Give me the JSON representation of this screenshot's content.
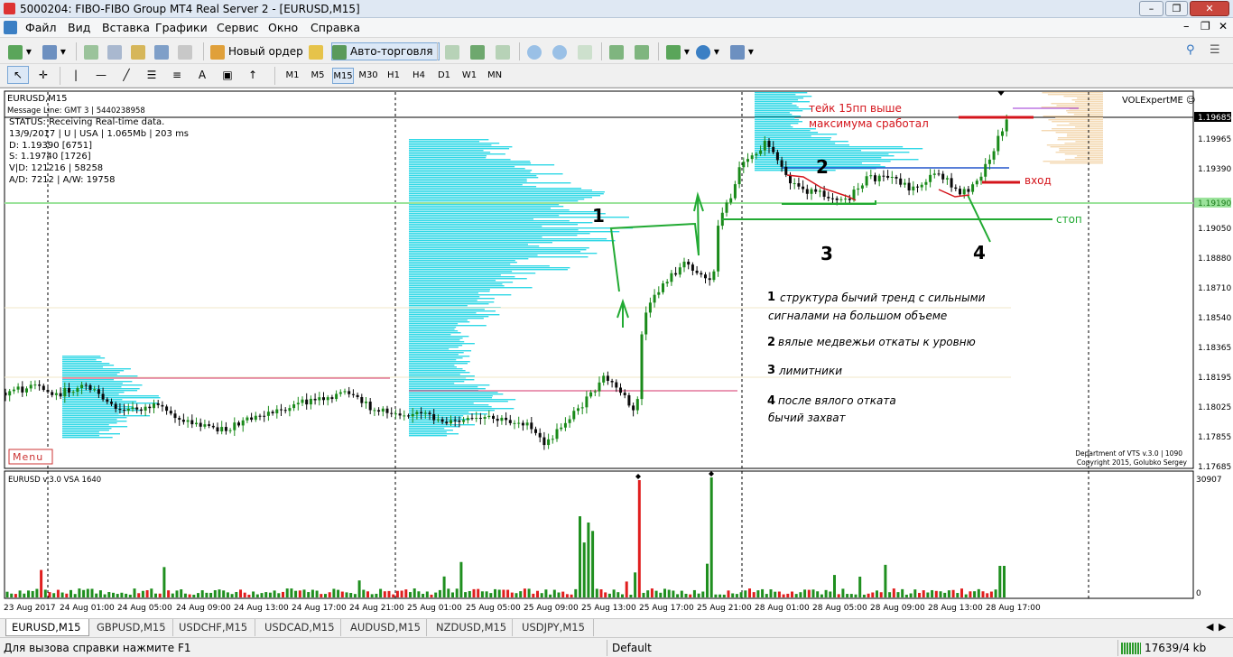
{
  "window": {
    "title": "5000204: FIBO-FIBO Group MT4 Real Server 2 - [EURUSD,M15]",
    "min": "–",
    "restore": "❐",
    "close": "✕"
  },
  "menu": [
    "Файл",
    "Вид",
    "Вставка",
    "Графики",
    "Сервис",
    "Окно",
    "Справка"
  ],
  "toolbar": {
    "new_order": "Новый ордер",
    "auto_trading": "Авто-торговля",
    "timeframes": [
      "M1",
      "M5",
      "M15",
      "M30",
      "H1",
      "H4",
      "D1",
      "W1",
      "MN"
    ],
    "active_timeframe": "M15"
  },
  "chart": {
    "symbol_line": "EURUSD,M15",
    "info_lines": [
      "Message Line: GMT 3 | 5440238958",
      "STATUS: Receiving Real-time data.",
      "13/9/2017 | U | USA | 1.065Mb | 203 ms",
      "D: 1.19390  [6751]",
      "S: 1.19740  [1726]",
      "V|D: 121216 | 58258",
      "A/D: 7212 | A/W: 19758"
    ],
    "expert": "VOLExpertME ☺",
    "menu_button": "Menu",
    "copyright_1": "Department of VTS  v.3.0 | 1090",
    "copyright_2": "Copyright 2015, Golubko Sergey",
    "indicator_label": "EURUSD v.3.0 VSA 1640",
    "price_labels": [
      "1.19965",
      "1.19390",
      "1.19050",
      "1.18880",
      "1.18710",
      "1.18540",
      "1.18365",
      "1.18195",
      "1.18025",
      "1.17855",
      "1.17685"
    ],
    "current_price": "1.19685",
    "line_price": "1.19190",
    "volume_labels": [
      "30907",
      "0"
    ],
    "time_labels": [
      "23 Aug 2017",
      "24 Aug 01:00",
      "24 Aug 05:00",
      "24 Aug 09:00",
      "24 Aug 13:00",
      "24 Aug 17:00",
      "24 Aug 21:00",
      "25 Aug 01:00",
      "25 Aug 05:00",
      "25 Aug 09:00",
      "25 Aug 13:00",
      "25 Aug 17:00",
      "25 Aug 21:00",
      "28 Aug 01:00",
      "28 Aug 05:00",
      "28 Aug 09:00",
      "28 Aug 13:00",
      "28 Aug 17:00"
    ],
    "annotations": {
      "take": [
        "тейк 15пп выше",
        "максимума сработал"
      ],
      "entry": "вход",
      "stop": "стоп",
      "num1": "1",
      "num2": "2",
      "num3": "3",
      "num4": "4",
      "note1_num": "1",
      "note1_a": "структура бычий тренд с сильными",
      "note1_b": "сигналами на большом объеме",
      "note2_num": "2",
      "note2": "вялые медвежьи откаты к уровню",
      "note3_num": "3",
      "note3": "лимитники",
      "note4_num": "4",
      "note4_a": "после вялого отката",
      "note4_b": "бычий захват"
    },
    "colors": {
      "bull": "#1a8a1a",
      "bear": "#0a0a0a",
      "profile": "#30d8e6",
      "annotation": "#d4141b",
      "green_line": "#22aa33"
    }
  },
  "tabs": [
    "EURUSD,M15",
    "GBPUSD,M15",
    "USDCHF,M15",
    "USDCAD,M15",
    "AUDUSD,M15",
    "NZDUSD,M15",
    "USDJPY,M15"
  ],
  "active_tab": "EURUSD,M15",
  "status": {
    "help": "Для вызова справки нажмите F1",
    "profile": "Default",
    "traffic": "17639/4 kb"
  }
}
